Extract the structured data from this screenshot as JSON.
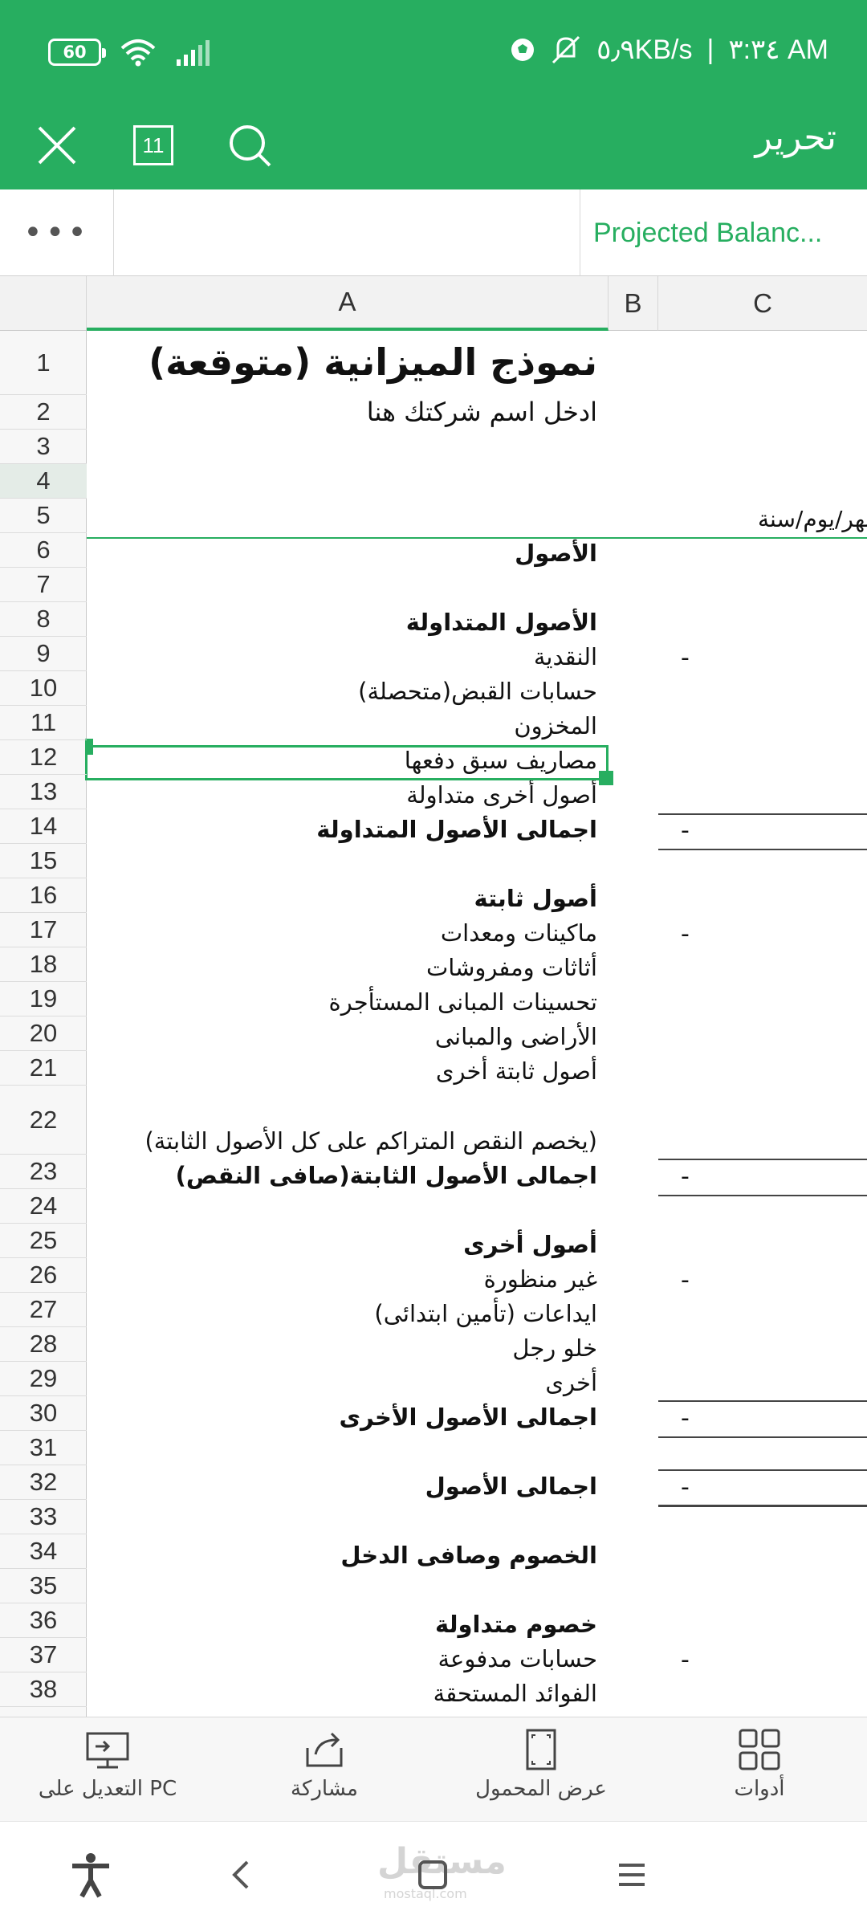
{
  "status_bar": {
    "battery": "60",
    "network_speed": "٥٫٩KB/s",
    "separator": "|",
    "time": "٣:٣٤ AM"
  },
  "toolbar": {
    "title": "تحرير",
    "sheet_count": "11",
    "icons": [
      "close-icon",
      "sheets-icon",
      "search-icon"
    ]
  },
  "tabs": {
    "more": "•••",
    "active_sheet": "Projected Balanc..."
  },
  "columns": [
    "A",
    "B",
    "C"
  ],
  "rows": {
    "numbers": [
      "1",
      "2",
      "3",
      "4",
      "5",
      "6",
      "7",
      "8",
      "9",
      "10",
      "11",
      "12",
      "13",
      "14",
      "15",
      "16",
      "17",
      "18",
      "19",
      "20",
      "21",
      "22",
      "23",
      "24",
      "25",
      "26",
      "27",
      "28",
      "29",
      "30",
      "31",
      "32",
      "33",
      "34",
      "35",
      "36",
      "37",
      "38"
    ],
    "active_row": "4"
  },
  "sheet": {
    "title": "نموذج الميزانية (متوقعة)",
    "company": "ادخل اسم شركتك هنا",
    "date_label": "شهر/يوم/سنة",
    "cells": {
      "r6": "الأصول",
      "r8": "الأصول المتداولة",
      "r9": "النقدية",
      "r10": "حسابات القبض(متحصلة)",
      "r11": "المخزون",
      "r12": "مصاريف سبق دفعها",
      "r13": "أصول أخرى متداولة",
      "r14": "اجمالى الأصول المتداولة",
      "r16": "أصول ثابتة",
      "r17": "ماكينات ومعدات",
      "r18": "أثاثات ومفروشات",
      "r19": "تحسينات المبانى المستأجرة",
      "r20": "الأراضى والمبانى",
      "r21": "أصول ثابتة أخرى",
      "r22": "(يخصم النقص المتراكم على كل الأصول الثابتة)",
      "r23": "اجمالى الأصول الثابتة(صافى النقص)",
      "r25": "أصول أخرى",
      "r26": "غير منظورة",
      "r27": "ايداعات (تأمين ابتدائى)",
      "r28": "خلو رجل",
      "r29": "أخرى",
      "r30": "اجمالى الأصول الأخرى",
      "r32": "اجمالى الأصول",
      "r34": "الخصوم وصافى الدخل",
      "r36": "خصوم متداولة",
      "r37": "حسابات مدفوعة",
      "r38": "الفوائد المستحقة"
    },
    "dash": "-"
  },
  "bottom_bar": {
    "items": [
      {
        "label": "التعديل على PC",
        "icon": "pc-edit-icon"
      },
      {
        "label": "مشاركة",
        "icon": "share-icon"
      },
      {
        "label": "عرض المحمول",
        "icon": "mobile-view-icon"
      },
      {
        "label": "أدوات",
        "icon": "tools-icon"
      }
    ]
  },
  "watermark": {
    "text": "مستقل",
    "sub": "mostaql.com"
  },
  "colors": {
    "accent": "#27ae60"
  }
}
